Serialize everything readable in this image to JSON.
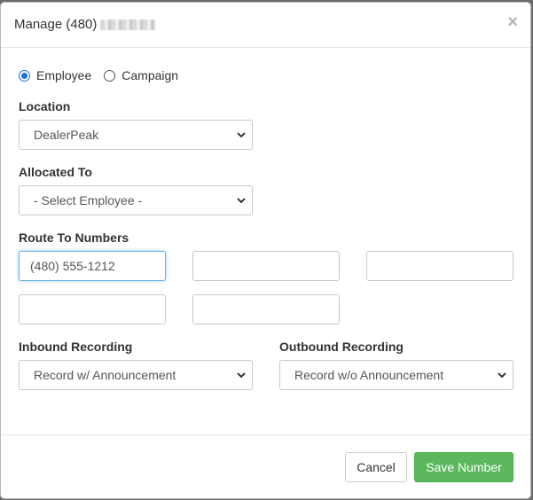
{
  "header": {
    "title": "Manage (480)",
    "close_symbol": "×"
  },
  "assign_type": {
    "options": [
      "Employee",
      "Campaign"
    ],
    "selected": "Employee"
  },
  "location": {
    "label": "Location",
    "value": "DealerPeak"
  },
  "allocated_to": {
    "label": "Allocated To",
    "value": "- Select Employee -"
  },
  "route_to_numbers": {
    "label": "Route To Numbers",
    "values": [
      "(480) 555-1212",
      "",
      "",
      "",
      ""
    ]
  },
  "inbound_recording": {
    "label": "Inbound Recording",
    "value": "Record w/ Announcement"
  },
  "outbound_recording": {
    "label": "Outbound Recording",
    "value": "Record w/o Announcement"
  },
  "footer": {
    "cancel_label": "Cancel",
    "save_label": "Save Number"
  },
  "colors": {
    "save_button": "#5cb85c",
    "radio_accent": "#1a73e8",
    "focus_border": "#66afe9"
  }
}
